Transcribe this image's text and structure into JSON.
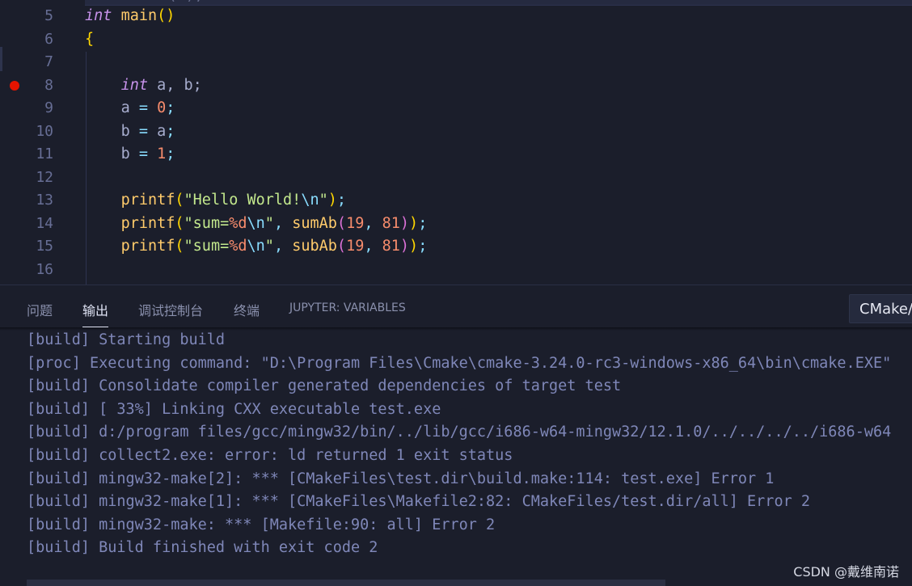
{
  "editor": {
    "top_fragment": "(        );",
    "lines": [
      {
        "num": "5",
        "breakpoint": false
      },
      {
        "num": "6",
        "breakpoint": false
      },
      {
        "num": "7",
        "breakpoint": false
      },
      {
        "num": "8",
        "breakpoint": true
      },
      {
        "num": "9",
        "breakpoint": false
      },
      {
        "num": "10",
        "breakpoint": false
      },
      {
        "num": "11",
        "breakpoint": false
      },
      {
        "num": "12",
        "breakpoint": false
      },
      {
        "num": "13",
        "breakpoint": false
      },
      {
        "num": "14",
        "breakpoint": false
      },
      {
        "num": "15",
        "breakpoint": false
      },
      {
        "num": "16",
        "breakpoint": false
      }
    ],
    "code": {
      "l5_kw": "int",
      "l5_name": "main",
      "l5_parens": "()",
      "l6_brace": "{",
      "l8_kw": "int",
      "l8_rest": "a, b;",
      "l9_var": "a",
      "l9_num": "0",
      "l10_a": "b",
      "l10_b": "a",
      "l11_var": "b",
      "l11_num": "1",
      "l13_fn": "printf",
      "l13_str": "\"Hello World!",
      "l13_esc": "\\n",
      "l13_strend": "\"",
      "l14_fn": "printf",
      "l14_str1": "\"sum=",
      "l14_fmt": "%d",
      "l14_esc": "\\n",
      "l14_strend": "\"",
      "l14_call": "sumAb",
      "l14_n1": "19",
      "l14_n2": "81",
      "l15_fn": "printf",
      "l15_str1": "\"sum=",
      "l15_fmt": "%d",
      "l15_esc": "\\n",
      "l15_strend": "\"",
      "l15_call": "subAb",
      "l15_n1": "19",
      "l15_n2": "81"
    }
  },
  "panel": {
    "tabs": [
      "问题",
      "输出",
      "调试控制台",
      "终端",
      "JUPYTER: VARIABLES"
    ],
    "active_tab": "输出",
    "channel_select": "CMake/Build",
    "output_lines": [
      "[build] Starting build",
      "[proc] Executing command: \"D:\\Program Files\\Cmake\\cmake-3.24.0-rc3-windows-x86_64\\bin\\cmake.EXE\"",
      "[build] Consolidate compiler generated dependencies of target test",
      "[build] [ 33%] Linking CXX executable test.exe",
      "[build] d:/program files/gcc/mingw32/bin/../lib/gcc/i686-w64-mingw32/12.1.0/../../../../i686-w64",
      "[build] collect2.exe: error: ld returned 1 exit status",
      "[build] mingw32-make[2]: *** [CMakeFiles\\test.dir\\build.make:114: test.exe] Error 1",
      "[build] mingw32-make[1]: *** [CMakeFiles\\Makefile2:82: CMakeFiles/test.dir/all] Error 2",
      "[build] mingw32-make: *** [Makefile:90: all] Error 2",
      "[build] Build finished with exit code 2"
    ]
  },
  "watermark": "CSDN @戴维南诺",
  "colors": {
    "background": "#1b1e2b",
    "breakpoint": "#e51400",
    "keyword": "#c792ea",
    "function": "#ffcb6b",
    "string": "#c3e88d",
    "number": "#f78c6c",
    "output_text": "#7f87b8"
  }
}
